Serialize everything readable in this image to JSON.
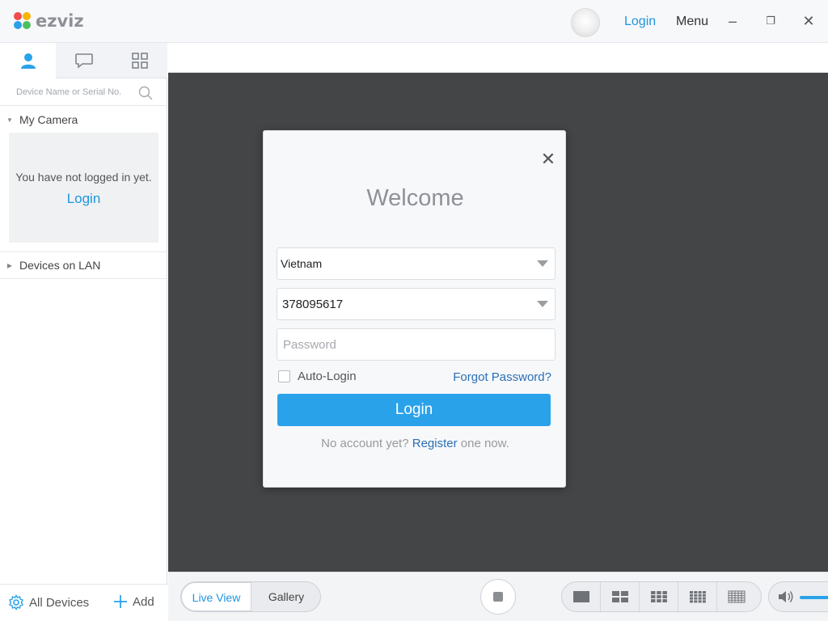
{
  "app": {
    "logo_text": "ezviz"
  },
  "titlebar": {
    "login_label": "Login",
    "menu_label": "Menu"
  },
  "sidebar": {
    "tabs": [
      {
        "icon": "user-icon",
        "active": true
      },
      {
        "icon": "message-icon",
        "active": false
      },
      {
        "icon": "grid-icon",
        "active": false
      }
    ],
    "search_placeholder": "Device Name or Serial No.",
    "my_camera_label": "My Camera",
    "not_logged_in_msg": "You have not logged in yet.",
    "login_link": "Login",
    "devices_on_lan_label": "Devices on LAN",
    "all_devices_label": "All Devices",
    "add_label": "Add"
  },
  "login_dialog": {
    "title": "Welcome",
    "country_value": "Vietnam",
    "account_value": "378095617",
    "password_placeholder": "Password",
    "auto_login_label": "Auto-Login",
    "forgot_password_label": "Forgot Password?",
    "login_button": "Login",
    "no_account_prefix": "No account yet?",
    "register_link": "Register",
    "no_account_suffix": "one now."
  },
  "bottombar": {
    "live_view_label": "Live View",
    "gallery_label": "Gallery"
  },
  "colors": {
    "accent": "#2aa2ea",
    "link": "#2a6fb5",
    "viewport_bg": "#444546"
  }
}
